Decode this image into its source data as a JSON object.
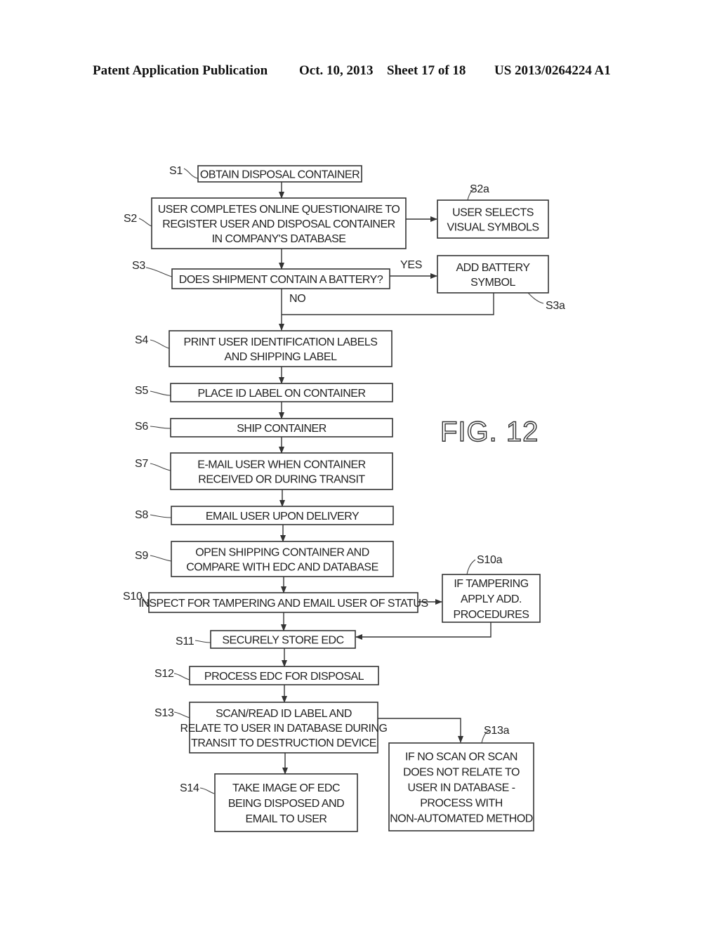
{
  "header": {
    "publication": "Patent Application Publication",
    "date": "Oct. 10, 2013",
    "sheet": "Sheet 17 of 18",
    "number": "US 2013/0264224 A1"
  },
  "figure_label": "FIG. 12",
  "steps": {
    "S1": {
      "id": "S1",
      "lines": [
        "OBTAIN DISPOSAL CONTAINER"
      ]
    },
    "S2": {
      "id": "S2",
      "lines": [
        "USER COMPLETES ONLINE QUESTIONAIRE TO",
        "REGISTER USER AND DISPOSAL CONTAINER",
        "IN COMPANY'S DATABASE"
      ]
    },
    "S2a": {
      "id": "S2a",
      "lines": [
        "USER SELECTS",
        "VISUAL SYMBOLS"
      ]
    },
    "S3": {
      "id": "S3",
      "lines": [
        "DOES SHIPMENT CONTAIN A BATTERY?"
      ]
    },
    "S3a": {
      "id": "S3a",
      "lines": [
        "ADD BATTERY",
        "SYMBOL"
      ]
    },
    "S4": {
      "id": "S4",
      "lines": [
        "PRINT USER IDENTIFICATION LABELS",
        "AND SHIPPING LABEL"
      ]
    },
    "S5": {
      "id": "S5",
      "lines": [
        "PLACE ID LABEL ON CONTAINER"
      ]
    },
    "S6": {
      "id": "S6",
      "lines": [
        "SHIP CONTAINER"
      ]
    },
    "S7": {
      "id": "S7",
      "lines": [
        "E-MAIL USER WHEN CONTAINER",
        "RECEIVED OR DURING TRANSIT"
      ]
    },
    "S8": {
      "id": "S8",
      "lines": [
        "EMAIL USER UPON DELIVERY"
      ]
    },
    "S9": {
      "id": "S9",
      "lines": [
        "OPEN SHIPPING CONTAINER AND",
        "COMPARE WITH EDC AND DATABASE"
      ]
    },
    "S10": {
      "id": "S10",
      "lines": [
        "INSPECT FOR TAMPERING AND EMAIL USER OF STATUS"
      ]
    },
    "S10a": {
      "id": "S10a",
      "lines": [
        "IF TAMPERING",
        "APPLY ADD.",
        "PROCEDURES"
      ]
    },
    "S11": {
      "id": "S11",
      "lines": [
        "SECURELY STORE EDC"
      ]
    },
    "S12": {
      "id": "S12",
      "lines": [
        "PROCESS EDC FOR DISPOSAL"
      ]
    },
    "S13": {
      "id": "S13",
      "lines": [
        "SCAN/READ ID LABEL AND",
        "RELATE TO USER IN DATABASE DURING",
        "TRANSIT TO DESTRUCTION DEVICE"
      ]
    },
    "S13a": {
      "id": "S13a",
      "lines": [
        "IF NO SCAN OR SCAN",
        "DOES NOT RELATE TO",
        "USER IN DATABASE -",
        "PROCESS WITH",
        "NON-AUTOMATED METHOD"
      ]
    },
    "S14": {
      "id": "S14",
      "lines": [
        "TAKE IMAGE OF EDC",
        "BEING DISPOSED AND",
        "EMAIL TO USER"
      ]
    }
  },
  "branches": {
    "yes": "YES",
    "no": "NO"
  }
}
